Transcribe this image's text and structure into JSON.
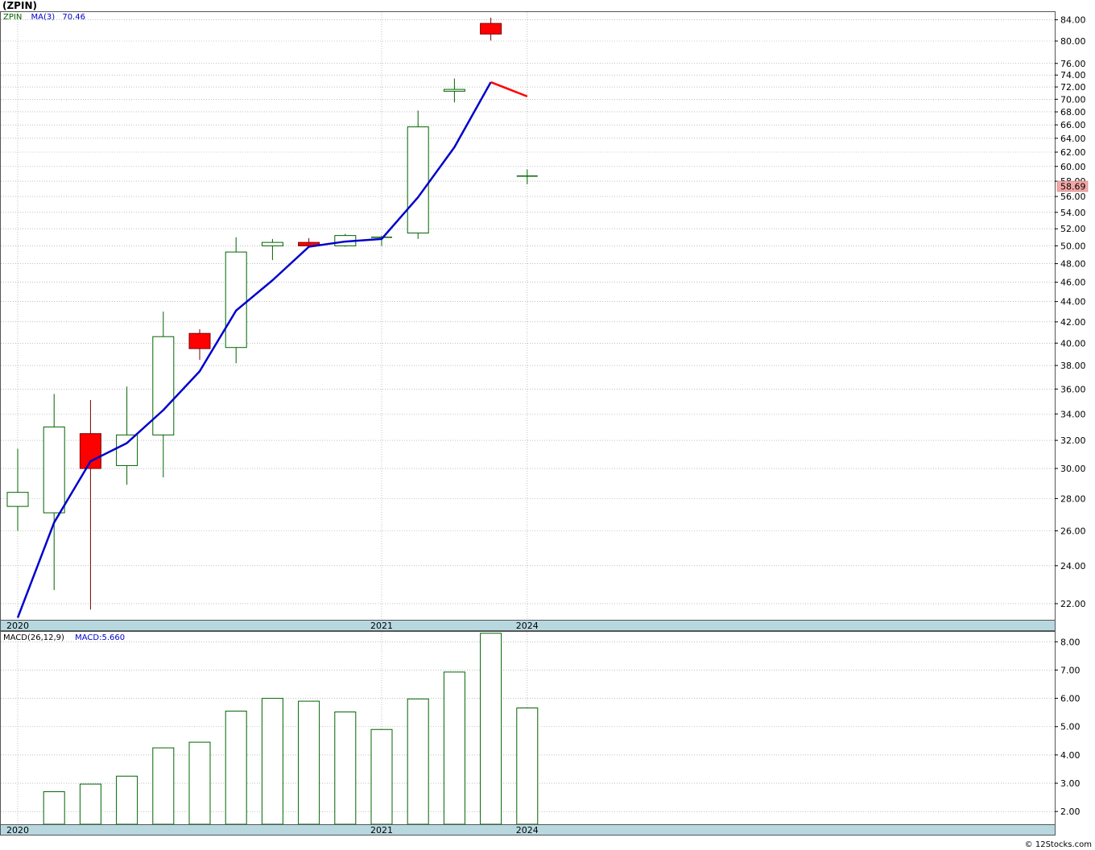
{
  "header": {
    "title": "(ZPIN)"
  },
  "colors": {
    "up": "#006400",
    "down_fill": "#ff0000",
    "ma": "#0000cc",
    "ma_down": "#ff0000",
    "axis_band": "#b8d8e0",
    "grid": "#999999",
    "price_badge": "#f4a7a7"
  },
  "legend": {
    "symbol": "ZPIN",
    "ma_label": "MA(3)",
    "ma_value": "70.46",
    "macd_label": "MACD(26,12,9)",
    "macd_value": "MACD:5.660"
  },
  "last_price_label": "58.69",
  "footer": {
    "copyright": "© 12Stocks.com"
  },
  "chart_data": [
    {
      "type": "candlestick",
      "scale": "log",
      "ylim": [
        21.2,
        85.5
      ],
      "x_labels": [
        {
          "label": "2020",
          "index": 0
        },
        {
          "label": "2021",
          "index": 10
        },
        {
          "label": "2024",
          "index": 14
        }
      ],
      "y_ticks": [
        22,
        24,
        26,
        28,
        30,
        32,
        34,
        36,
        38,
        40,
        42,
        44,
        46,
        48,
        50,
        52,
        54,
        56,
        58,
        60,
        62,
        64,
        66,
        68,
        70,
        72,
        74,
        76,
        80,
        84
      ],
      "candles": [
        {
          "open": 27.5,
          "high": 31.4,
          "low": 26.0,
          "close": 28.4
        },
        {
          "open": 27.1,
          "high": 35.6,
          "low": 22.7,
          "close": 33.0
        },
        {
          "open": 32.5,
          "high": 35.1,
          "low": 21.7,
          "close": 30.0
        },
        {
          "open": 30.2,
          "high": 36.2,
          "low": 28.9,
          "close": 32.4
        },
        {
          "open": 32.4,
          "high": 43.0,
          "low": 29.4,
          "close": 40.6
        },
        {
          "open": 40.9,
          "high": 41.3,
          "low": 38.5,
          "close": 39.5
        },
        {
          "open": 39.6,
          "high": 51.0,
          "low": 38.2,
          "close": 49.3
        },
        {
          "open": 50.0,
          "high": 50.8,
          "low": 48.4,
          "close": 50.4
        },
        {
          "open": 50.4,
          "high": 50.9,
          "low": 49.8,
          "close": 50.0
        },
        {
          "open": 50.0,
          "high": 51.4,
          "low": 49.9,
          "close": 51.2
        },
        {
          "open": 51.0,
          "high": 51.2,
          "low": 50.0,
          "close": 51.0
        },
        {
          "open": 51.5,
          "high": 68.2,
          "low": 50.8,
          "close": 65.7
        },
        {
          "open": 71.3,
          "high": 73.4,
          "low": 69.5,
          "close": 71.6
        },
        {
          "open": 83.3,
          "high": 84.4,
          "low": 80.1,
          "close": 81.3
        },
        {
          "open": 58.69,
          "high": 59.6,
          "low": 57.6,
          "close": 58.69
        }
      ],
      "ma3": [
        21.3,
        26.5,
        30.5,
        31.8,
        34.3,
        37.5,
        43.1,
        46.2,
        49.9,
        50.5,
        50.8,
        55.9,
        62.7,
        72.8,
        70.46
      ]
    },
    {
      "type": "bar",
      "title": "MACD(26,12,9)",
      "ylim": [
        1.55,
        8.35
      ],
      "y_ticks": [
        2,
        3,
        4,
        5,
        6,
        7,
        8
      ],
      "values": [
        null,
        2.7,
        2.97,
        3.25,
        4.25,
        4.45,
        5.55,
        6.0,
        5.9,
        5.52,
        4.9,
        5.98,
        6.93,
        8.3,
        5.66
      ]
    }
  ]
}
